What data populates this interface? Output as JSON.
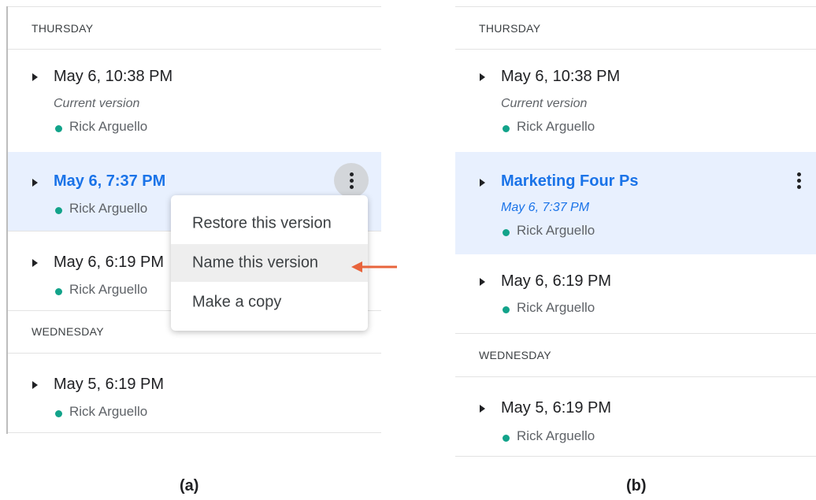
{
  "panel_a": {
    "groups": [
      {
        "day": "THURSDAY",
        "entries": [
          {
            "title": "May 6, 10:38 PM",
            "subtitle": "Current version",
            "author": "Rick Arguello"
          },
          {
            "title": "May 6, 7:37 PM",
            "author": "Rick Arguello",
            "selected": true
          },
          {
            "title": "May 6, 6:19 PM",
            "author": "Rick Arguello"
          }
        ]
      },
      {
        "day": "WEDNESDAY",
        "entries": [
          {
            "title": "May 5, 6:19 PM",
            "author": "Rick Arguello"
          }
        ]
      }
    ],
    "menu": [
      "Restore this version",
      "Name this version",
      "Make a copy"
    ],
    "menu_highlighted": "Name this version",
    "caption": "(a)"
  },
  "panel_b": {
    "groups": [
      {
        "day": "THURSDAY",
        "entries": [
          {
            "title": "May 6, 10:38 PM",
            "subtitle": "Current version",
            "author": "Rick Arguello"
          },
          {
            "title": "Marketing Four Ps",
            "subtitle": "May 6, 7:37 PM",
            "author": "Rick Arguello",
            "selected": true
          },
          {
            "title": "May 6, 6:19 PM",
            "author": "Rick Arguello"
          }
        ]
      },
      {
        "day": "WEDNESDAY",
        "entries": [
          {
            "title": "May 5, 6:19 PM",
            "author": "Rick Arguello"
          }
        ]
      }
    ],
    "caption": "(b)"
  },
  "colors": {
    "accent": "#1a73e8",
    "selected_bg": "#e8f0fe",
    "author_dot": "#12a38a",
    "arrow": "#e8643c"
  },
  "icons": {
    "expand": "triangle-right-icon",
    "more": "more-vert-icon",
    "author": "dot-icon",
    "pointer": "arrow-left-icon"
  }
}
